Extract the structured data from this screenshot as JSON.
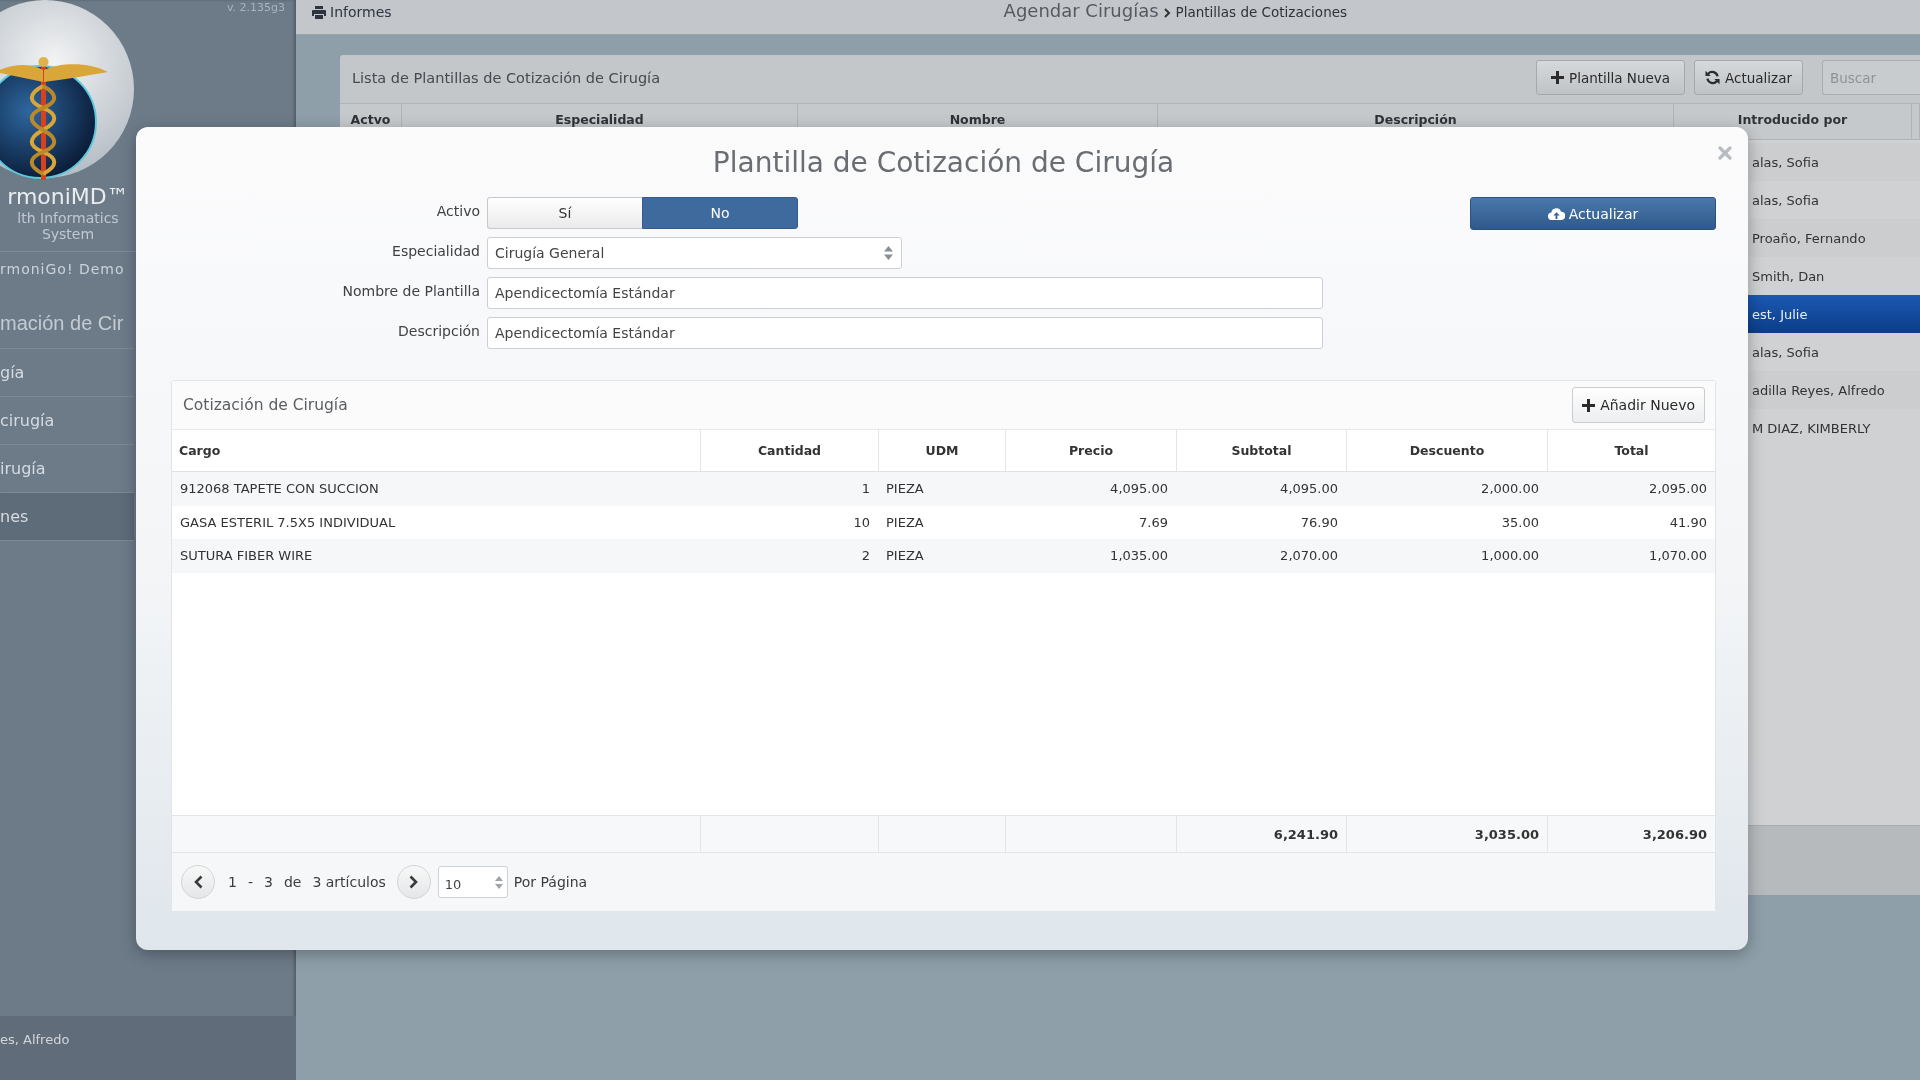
{
  "sidebar": {
    "version": "v. 2.135g3",
    "logo_lines": [
      "rmoniMD™",
      "lth Informatics",
      "System"
    ],
    "clinic": "rmoniGo! Demo",
    "section_title": "mación de Cir",
    "items": [
      {
        "label": "gía",
        "selected": false
      },
      {
        "label": "cirugía",
        "selected": false
      },
      {
        "label": "irugía",
        "selected": false
      },
      {
        "label": "nes",
        "selected": true
      }
    ],
    "user": "es, Alfredo"
  },
  "top_bar": {
    "reports_link": "Informes",
    "breadcrumb": {
      "section": "Agendar Cirugías",
      "page": "Plantillas de Cotizaciones"
    }
  },
  "template_list": {
    "title": "Lista de Plantillas de Cotización de Cirugía",
    "buttons": [
      {
        "kind": "add",
        "label": "Plantilla Nueva"
      },
      {
        "kind": "refresh",
        "label": "Actualizar"
      }
    ],
    "search": {
      "placeholder": "Buscar"
    },
    "columns": [
      "Actvo",
      "Especialidad",
      "Nombre",
      "Descripción",
      "Introducido por"
    ],
    "rows": [
      {
        "entered_by": "alas, Sofia",
        "selected": false
      },
      {
        "entered_by": "alas, Sofia",
        "selected": false
      },
      {
        "entered_by": "Proaño, Fernando",
        "selected": false
      },
      {
        "entered_by": "Smith, Dan",
        "selected": false
      },
      {
        "entered_by": "est, Julie",
        "selected": true
      },
      {
        "entered_by": "alas, Sofia",
        "selected": false
      },
      {
        "entered_by": "adilla Reyes, Alfredo",
        "selected": false
      },
      {
        "entered_by": "M DIAZ, KIMBERLY",
        "selected": false
      }
    ]
  },
  "modal": {
    "title": "Plantilla de Cotización de Cirugía",
    "active": {
      "label": "Activo",
      "options": [
        {
          "label": "Sí",
          "selected": false
        },
        {
          "label": "No",
          "selected": true
        }
      ]
    },
    "update_button": "Actualizar",
    "fields": [
      {
        "kind": "select",
        "label": "Especialidad",
        "value": "Cirugía General"
      },
      {
        "kind": "text",
        "label": "Nombre de Plantilla",
        "value": "Apendicectomía Estándar"
      },
      {
        "kind": "text",
        "label": "Descripción",
        "value": "Apendicectomía Estándar"
      }
    ],
    "quote": {
      "title": "Cotización de Cirugía",
      "add_button": "Añadir Nuevo",
      "columns": [
        {
          "label": "Cargo",
          "kind": "text"
        },
        {
          "label": "Cantidad",
          "kind": "number"
        },
        {
          "label": "UDM",
          "kind": "text"
        },
        {
          "label": "Precio",
          "kind": "number"
        },
        {
          "label": "Subtotal",
          "kind": "number"
        },
        {
          "label": "Descuento",
          "kind": "number"
        },
        {
          "label": "Total",
          "kind": "number"
        }
      ],
      "rows": [
        [
          "912068 TAPETE CON SUCCION",
          "1",
          "PIEZA",
          "4,095.00",
          "4,095.00",
          "2,000.00",
          "2,095.00"
        ],
        [
          "GASA ESTERIL 7.5X5 INDIVIDUAL",
          "10",
          "PIEZA",
          "7.69",
          "76.90",
          "35.00",
          "41.90"
        ],
        [
          "SUTURA FIBER WIRE",
          "2",
          "PIEZA",
          "1,035.00",
          "2,070.00",
          "1,000.00",
          "1,070.00"
        ]
      ],
      "totals": [
        "6,241.90",
        "3,035.00",
        "3,206.90"
      ],
      "pager": {
        "info": [
          "1",
          "-",
          "3",
          "de",
          "3 artículos"
        ],
        "page_size": "10",
        "per_page_label": "Por Página"
      }
    }
  }
}
